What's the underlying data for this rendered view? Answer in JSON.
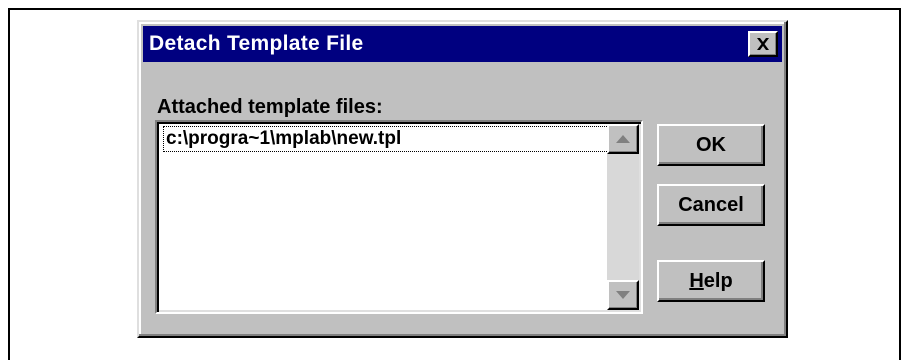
{
  "dialog": {
    "title": "Detach Template File",
    "close_icon": "close-icon",
    "list_label": "Attached template files:",
    "files": [
      "c:\\progra~1\\mplab\\new.tpl"
    ],
    "buttons": {
      "ok": "OK",
      "cancel": "Cancel",
      "help_mnemonic": "H",
      "help_rest": "elp"
    }
  }
}
